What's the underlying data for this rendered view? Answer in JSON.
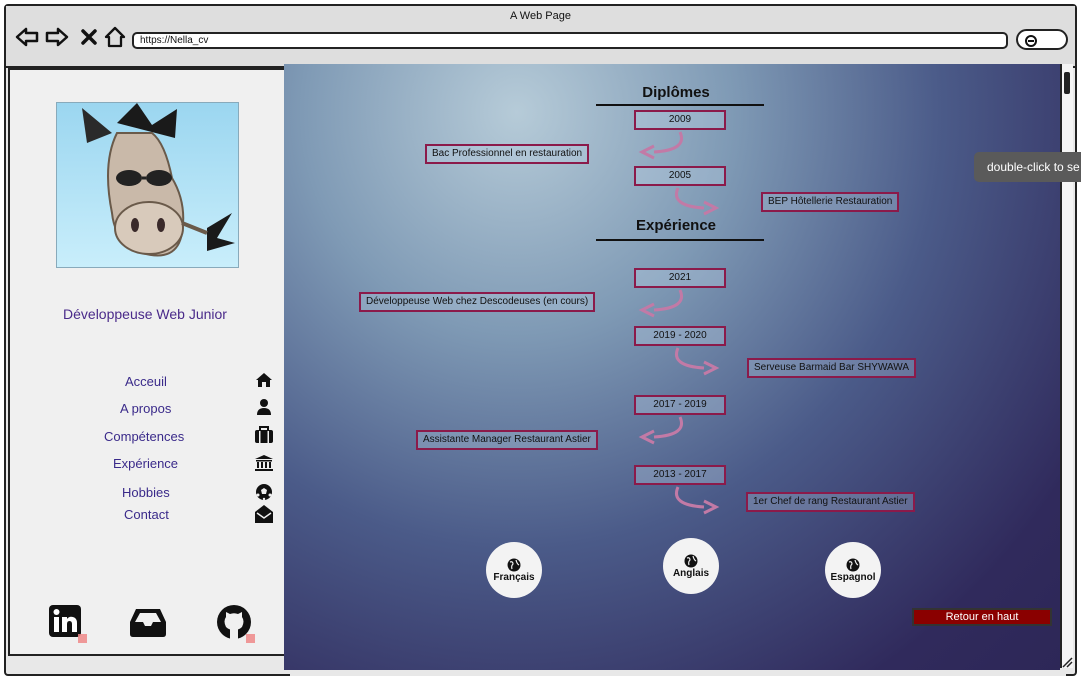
{
  "window": {
    "title": "A Web Page"
  },
  "toolbar": {
    "url": "https://Nella_cv"
  },
  "sidebar": {
    "role": "Développeuse Web Junior",
    "menu": [
      {
        "label": "Acceuil",
        "icon": "home-icon"
      },
      {
        "label": "A propos",
        "icon": "user-icon"
      },
      {
        "label": "Compétences",
        "icon": "briefcase-icon"
      },
      {
        "label": "Expérience",
        "icon": "bank-icon"
      },
      {
        "label": "Hobbies",
        "icon": "soccer-ball-icon"
      },
      {
        "label": "Contact",
        "icon": "envelope-open-icon"
      }
    ],
    "social": [
      "linkedin-icon",
      "inbox-icon",
      "github-icon"
    ]
  },
  "diplomes": {
    "title": "Diplômes",
    "items": [
      {
        "year": "2009",
        "label": "Bac Professionnel en restauration"
      },
      {
        "year": "2005",
        "label": "BEP Hôtellerie Restauration"
      }
    ]
  },
  "experience": {
    "title": "Expérience",
    "items": [
      {
        "year": "2021",
        "label": "Développeuse Web chez Descodeuses (en cours)"
      },
      {
        "year": "2019 - 2020",
        "label": "Serveuse Barmaid Bar SHYWAWA"
      },
      {
        "year": "2017 - 2019",
        "label": "Assistante Manager Restaurant Astier"
      },
      {
        "year": "2013 - 2017",
        "label": "1er Chef de rang Restaurant Astier"
      }
    ]
  },
  "languages": [
    {
      "label": "Français",
      "icon": "globe-icon"
    },
    {
      "label": "Anglais",
      "icon": "globe-icon"
    },
    {
      "label": "Espagnol",
      "icon": "globe-icon"
    }
  ],
  "back_to_top": "Retour en haut",
  "tooltip": "double-click to se",
  "colors": {
    "accent": "#8b1a4a",
    "arrow": "#c27aa6",
    "button": "#8a0000",
    "menu_text": "#3a2a8a"
  }
}
